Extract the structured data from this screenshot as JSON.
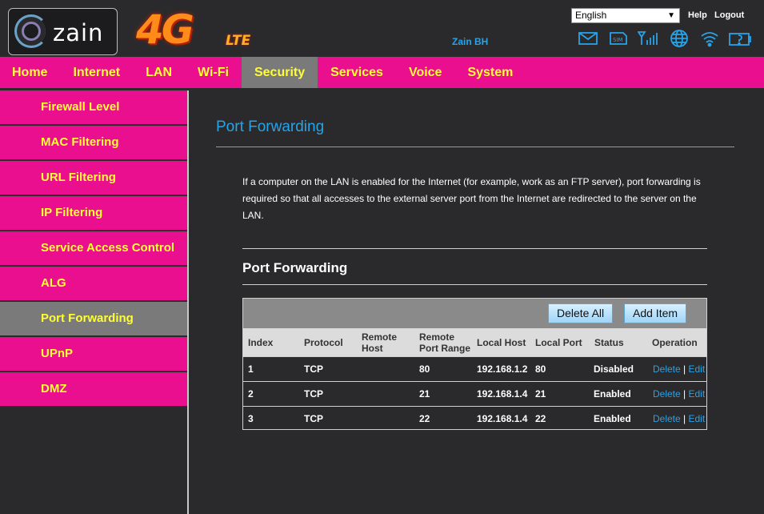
{
  "header": {
    "brand": "zain",
    "product_big": "4G",
    "product_small": "LTE",
    "operator": "Zain BH",
    "language": "English",
    "help": "Help",
    "logout": "Logout",
    "status_icons": [
      "mail-icon",
      "sim-icon",
      "signal-icon",
      "globe-icon",
      "wifi-icon",
      "battery-icon"
    ]
  },
  "nav": {
    "items": [
      "Home",
      "Internet",
      "LAN",
      "Wi-Fi",
      "Security",
      "Services",
      "Voice",
      "System"
    ],
    "active": "Security"
  },
  "sidebar": {
    "items": [
      "Firewall Level",
      "MAC Filtering",
      "URL Filtering",
      "IP Filtering",
      "Service Access Control",
      "ALG",
      "Port Forwarding",
      "UPnP",
      "DMZ"
    ],
    "active": "Port Forwarding"
  },
  "main": {
    "title": "Port Forwarding",
    "description": "If a computer on the LAN is enabled for the Internet (for example, work as an FTP server), port forwarding is required so that all accesses to the external server port from the Internet are redirected to the server on the LAN.",
    "section_title": "Port Forwarding",
    "delete_all": "Delete All",
    "add_item": "Add Item",
    "columns": [
      "Index",
      "Protocol",
      "Remote Host",
      "Remote Port Range",
      "Local Host",
      "Local Port",
      "Status",
      "Operation"
    ],
    "rows": [
      {
        "index": "1",
        "protocol": "TCP",
        "remote_host": "",
        "remote_port": "80",
        "local_host": "192.168.1.2",
        "local_port": "80",
        "status": "Disabled"
      },
      {
        "index": "2",
        "protocol": "TCP",
        "remote_host": "",
        "remote_port": "21",
        "local_host": "192.168.1.4",
        "local_port": "21",
        "status": "Enabled"
      },
      {
        "index": "3",
        "protocol": "TCP",
        "remote_host": "",
        "remote_port": "22",
        "local_host": "192.168.1.4",
        "local_port": "22",
        "status": "Enabled"
      }
    ],
    "delete_label": "Delete",
    "edit_label": "Edit",
    "separator": "|"
  },
  "colors": {
    "accent": "#ea0f8f",
    "nav_text": "#ffff33",
    "link": "#27a3e8",
    "background": "#2a2a2c"
  }
}
